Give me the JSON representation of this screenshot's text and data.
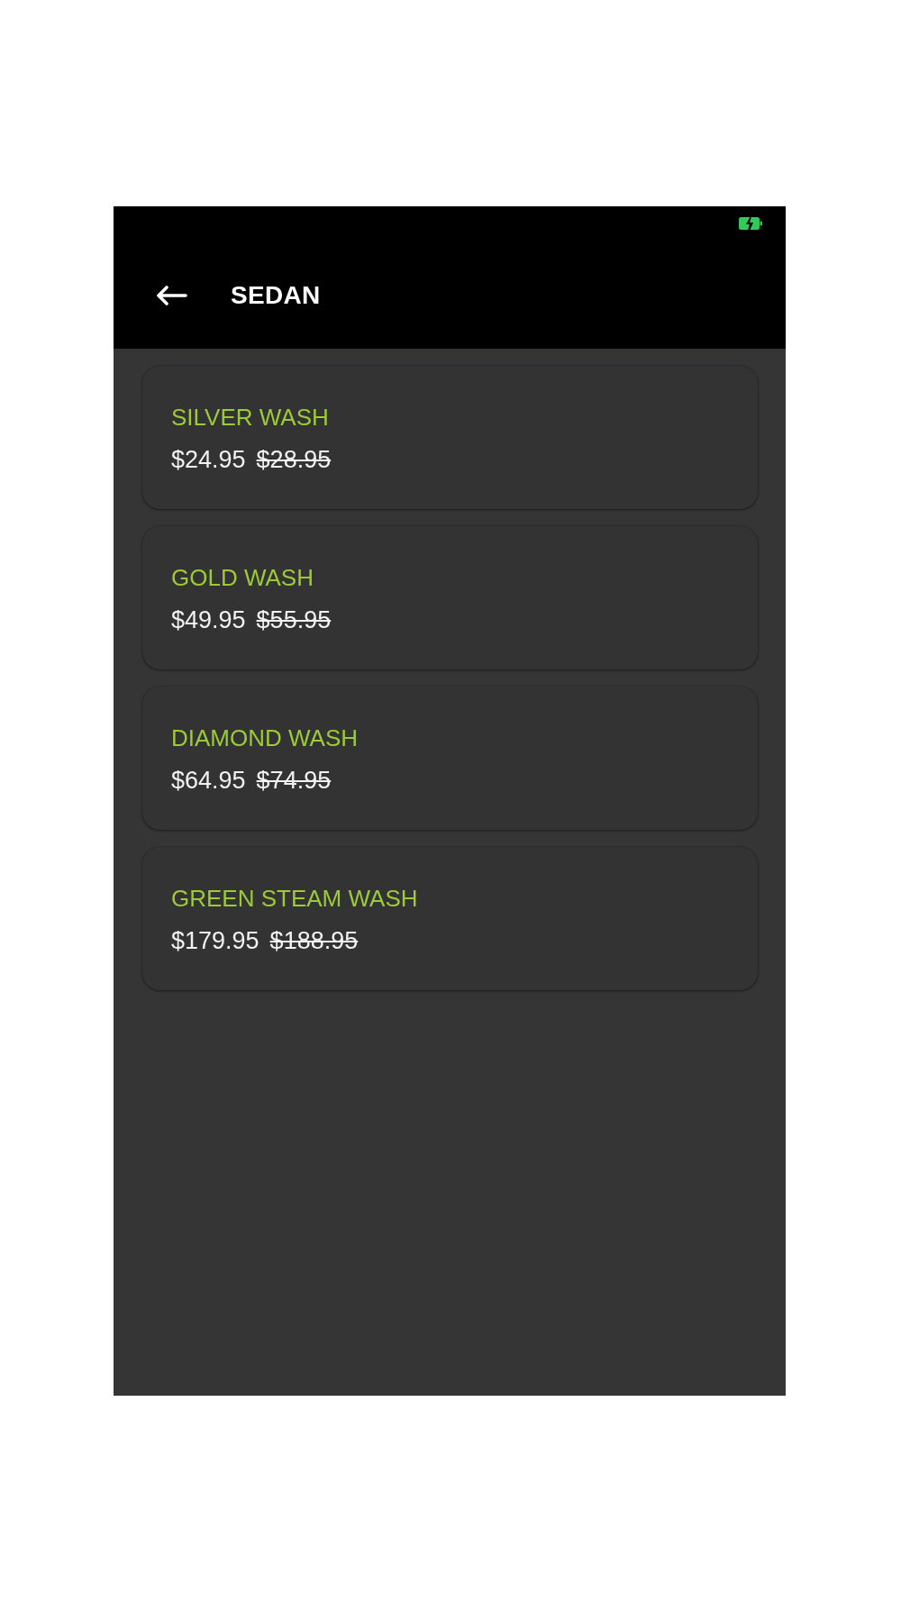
{
  "app_bar": {
    "title": "SEDAN"
  },
  "packages": [
    {
      "name": "SILVER WASH",
      "price": "$24.95",
      "original_price": "$28.95"
    },
    {
      "name": "GOLD WASH",
      "price": "$49.95",
      "original_price": "$55.95"
    },
    {
      "name": "DIAMOND WASH",
      "price": "$64.95",
      "original_price": "$74.95"
    },
    {
      "name": "GREEN STEAM WASH",
      "price": "$179.95",
      "original_price": "$188.95"
    }
  ]
}
